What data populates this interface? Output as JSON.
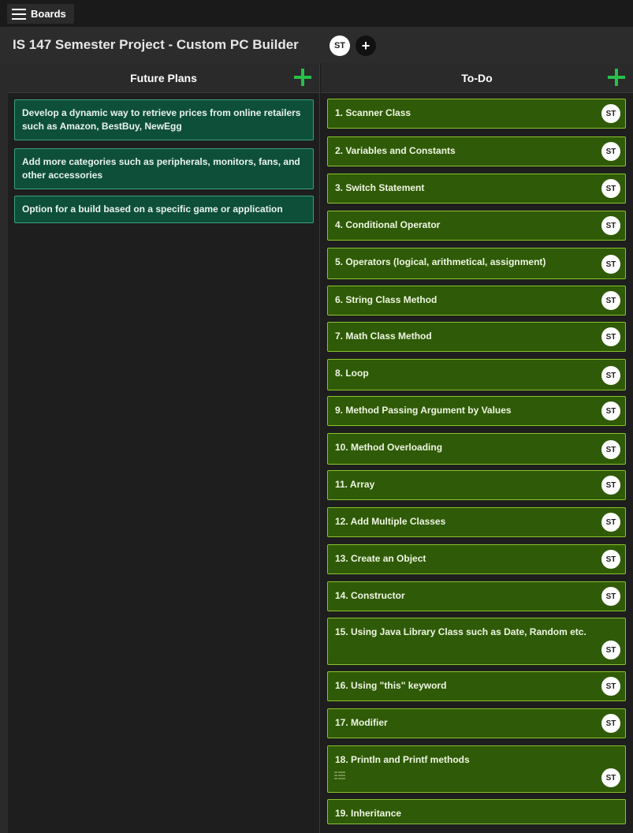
{
  "topbar": {
    "boards_label": "Boards"
  },
  "board": {
    "title": "IS 147 Semester Project - Custom PC Builder",
    "member_initials": "ST",
    "add_member_label": "+"
  },
  "columns": {
    "future": {
      "title": "Future Plans",
      "cards": [
        "Develop a dynamic way to retrieve prices from online retailers such as Amazon, BestBuy, NewEgg",
        "Add more categories such as peripherals, monitors, fans, and other accessories",
        "Option for a build based on a specific game or application"
      ]
    },
    "todo": {
      "title": "To-Do",
      "cards": [
        {
          "label": "1. Scanner Class",
          "assignee": "ST"
        },
        {
          "label": "2. Variables and Constants",
          "assignee": "ST"
        },
        {
          "label": "3. Switch Statement",
          "assignee": "ST"
        },
        {
          "label": "4. Conditional Operator",
          "assignee": "ST"
        },
        {
          "label": "5. Operators (logical, arithmetical, assignment)",
          "assignee": "ST"
        },
        {
          "label": "6. String Class Method",
          "assignee": "ST"
        },
        {
          "label": "7. Math Class Method",
          "assignee": "ST"
        },
        {
          "label": "8. Loop",
          "assignee": "ST"
        },
        {
          "label": "9. Method Passing Argument by Values",
          "assignee": "ST"
        },
        {
          "label": "10. Method Overloading",
          "assignee": "ST"
        },
        {
          "label": "11. Array",
          "assignee": "ST"
        },
        {
          "label": "12. Add Multiple Classes",
          "assignee": "ST"
        },
        {
          "label": "13. Create an Object",
          "assignee": "ST"
        },
        {
          "label": "14. Constructor",
          "assignee": "ST"
        },
        {
          "label": "15. Using Java Library Class such as Date, Random etc.",
          "assignee": "ST"
        },
        {
          "label": "16. Using \"this\" keyword",
          "assignee": "ST"
        },
        {
          "label": "17. Modifier",
          "assignee": "ST"
        },
        {
          "label": "18. Println and Printf methods",
          "assignee": "ST",
          "checklist_icon": "checklist-icon"
        },
        {
          "label": "19. Inheritance"
        }
      ]
    }
  },
  "colors": {
    "future_card_bg": "#0e4f3a",
    "todo_card_bg": "#2f5a07",
    "add_green": "#27c04a"
  }
}
